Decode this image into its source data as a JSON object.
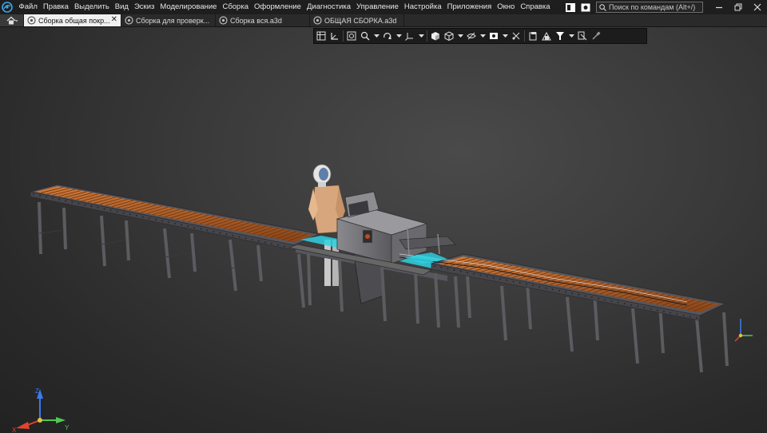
{
  "menubar": {
    "items": [
      "Файл",
      "Правка",
      "Выделить",
      "Вид",
      "Эскиз",
      "Моделирование",
      "Сборка",
      "Оформление",
      "Диагностика",
      "Управление",
      "Настройка",
      "Приложения",
      "Окно",
      "Справка"
    ],
    "search_placeholder": "Поиск по командам (Alt+/)"
  },
  "tabs": [
    {
      "label": "Сборка общая покр...",
      "active": true,
      "closable": true
    },
    {
      "label": "Сборка для проверк...",
      "active": false,
      "closable": false
    },
    {
      "label": "Сборка вся.а3d",
      "active": false,
      "closable": false
    },
    {
      "label": "ОБЩАЯ СБОРКА.а3d",
      "active": false,
      "closable": false
    }
  ],
  "tab_close_glyph": "✕",
  "icons": {
    "app_logo": "kompas-logo-icon",
    "home": "home-icon",
    "search": "search-icon",
    "minimize": "minimize-icon",
    "restore": "restore-icon",
    "close": "close-icon"
  },
  "view_toolbar": {
    "buttons": [
      "grid-icon",
      "orient-icon",
      "zoom-fit-icon",
      "zoom-icon",
      "rotate-icon",
      "axes-icon",
      "shaded-icon",
      "wireframe-icon",
      "hide-icon",
      "display-icon",
      "section-icon",
      "cut-icon",
      "perspective-icon",
      "filter-icon",
      "select-icon",
      "eyedropper-icon"
    ]
  },
  "colors": {
    "menubar_bg": "#1e1e1e",
    "tab_active_bg": "#f0f0f0",
    "viewport_center": "#4a4a4a",
    "roller": "#b4622a",
    "frame": "#4c4c52",
    "accent_cyan": "#2fd1e0",
    "axis_x": "#e0452e",
    "axis_y": "#4ec94e",
    "axis_z": "#3a7bf0"
  },
  "triad_labels": {
    "x": "X",
    "y": "Y",
    "z": "Z"
  }
}
